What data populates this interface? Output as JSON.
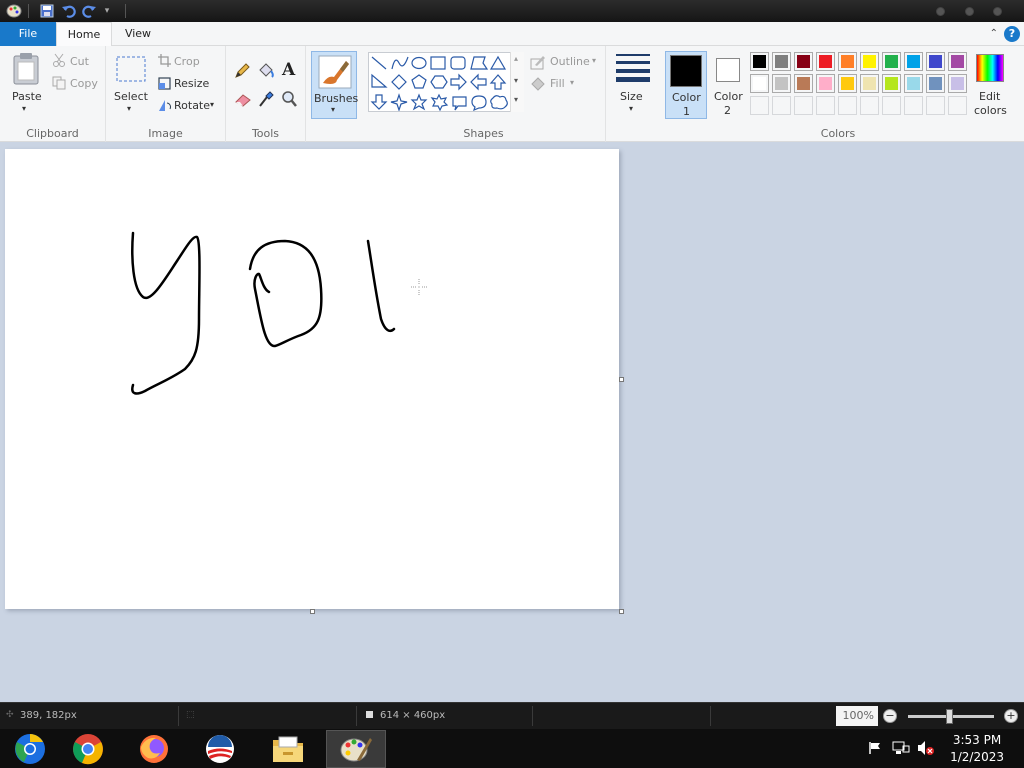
{
  "tabs": {
    "file": "File",
    "home": "Home",
    "view": "View"
  },
  "help_label": "?",
  "clipboard": {
    "paste": "Paste",
    "cut": "Cut",
    "copy": "Copy",
    "group": "Clipboard"
  },
  "image": {
    "select": "Select",
    "crop": "Crop",
    "resize": "Resize",
    "rotate": "Rotate",
    "group": "Image"
  },
  "tools": {
    "group": "Tools"
  },
  "brushes": {
    "label": "Brushes"
  },
  "shapes": {
    "outline": "Outline",
    "fill": "Fill",
    "group": "Shapes"
  },
  "size": {
    "label": "Size"
  },
  "color1": {
    "label": "Color",
    "num": "1",
    "value": "#000000"
  },
  "color2": {
    "label": "Color",
    "num": "2",
    "value": "#ffffff"
  },
  "colors": {
    "edit_line1": "Edit",
    "edit_line2": "colors",
    "group": "Colors",
    "row1": [
      "#000000",
      "#7f7f7f",
      "#880015",
      "#ed1c24",
      "#ff7f27",
      "#fff200",
      "#22b14c",
      "#00a2e8",
      "#3f48cc",
      "#a349a4"
    ],
    "row2": [
      "#ffffff",
      "#c3c3c3",
      "#b97a57",
      "#ffaec9",
      "#ffc90e",
      "#efe4b0",
      "#b5e61d",
      "#99d9ea",
      "#7092be",
      "#c8bfe7"
    ],
    "row3": [
      "#f5f6f7",
      "#f5f6f7",
      "#f5f6f7",
      "#f5f6f7",
      "#f5f6f7",
      "#f5f6f7",
      "#f5f6f7",
      "#f5f6f7",
      "#f5f6f7",
      "#f5f6f7"
    ]
  },
  "status": {
    "cursor_pos": "389, 182px",
    "canvas_size": "614 × 460px",
    "zoom": "100%"
  },
  "taskbar": {
    "time": "3:53 PM",
    "date": "1/2/2023"
  }
}
